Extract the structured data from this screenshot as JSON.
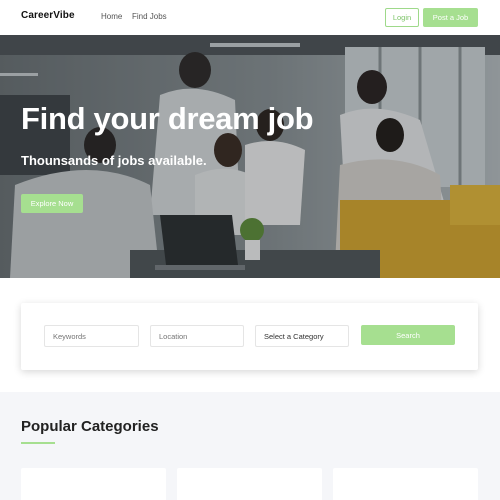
{
  "navbar": {
    "brand": "CareerVibe",
    "links": [
      "Home",
      "Find Jobs"
    ],
    "login_label": "Login",
    "post_job_label": "Post a Job"
  },
  "hero": {
    "title": "Find your dream job",
    "subtitle": "Thounsands of jobs available.",
    "cta_label": "Explore Now"
  },
  "search": {
    "keywords_placeholder": "Keywords",
    "location_placeholder": "Location",
    "category_selected": "Select a Category",
    "search_label": "Search"
  },
  "categories": {
    "title": "Popular Categories"
  },
  "colors": {
    "accent": "#a6df90",
    "accent_text": "#7cc467",
    "section_bg": "#f5f6f9"
  }
}
